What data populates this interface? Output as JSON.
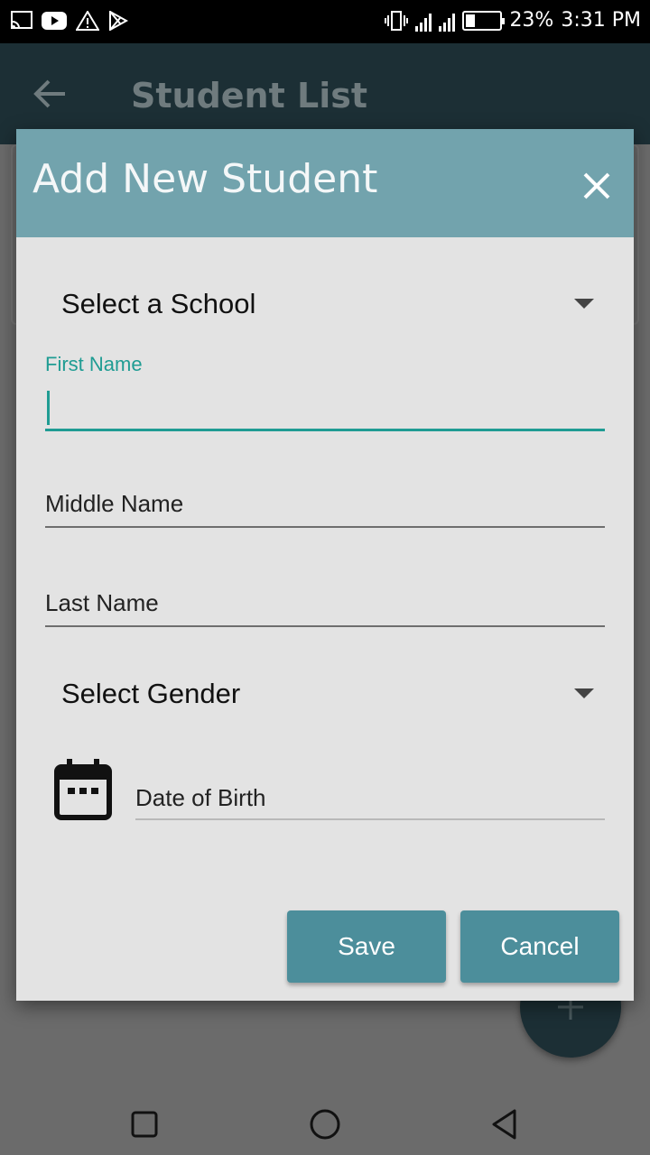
{
  "status_bar": {
    "battery_percent": "23%",
    "time": "3:31 PM"
  },
  "app_bar": {
    "title": "Student List"
  },
  "dialog": {
    "title": "Add New Student",
    "school_dropdown": {
      "selected": "Select a School"
    },
    "first_name": {
      "label": "First Name",
      "value": ""
    },
    "middle_name": {
      "placeholder": "Middle Name"
    },
    "last_name": {
      "placeholder": "Last Name"
    },
    "gender_dropdown": {
      "selected": "Select Gender"
    },
    "date_of_birth": {
      "placeholder": "Date of Birth"
    },
    "buttons": {
      "save": "Save",
      "cancel": "Cancel"
    }
  },
  "colors": {
    "dialog_header": "#72a3ad",
    "accent": "#1f9c93",
    "button": "#4c8e9b",
    "app_bar": "#1c2f35"
  },
  "icons": [
    "cast-icon",
    "youtube-icon",
    "warning-icon",
    "play-store-icon",
    "vibrate-icon",
    "signal-icon",
    "battery-icon",
    "back-arrow-icon",
    "close-icon",
    "calendar-icon",
    "add-icon",
    "recents-icon",
    "home-icon",
    "back-icon"
  ]
}
